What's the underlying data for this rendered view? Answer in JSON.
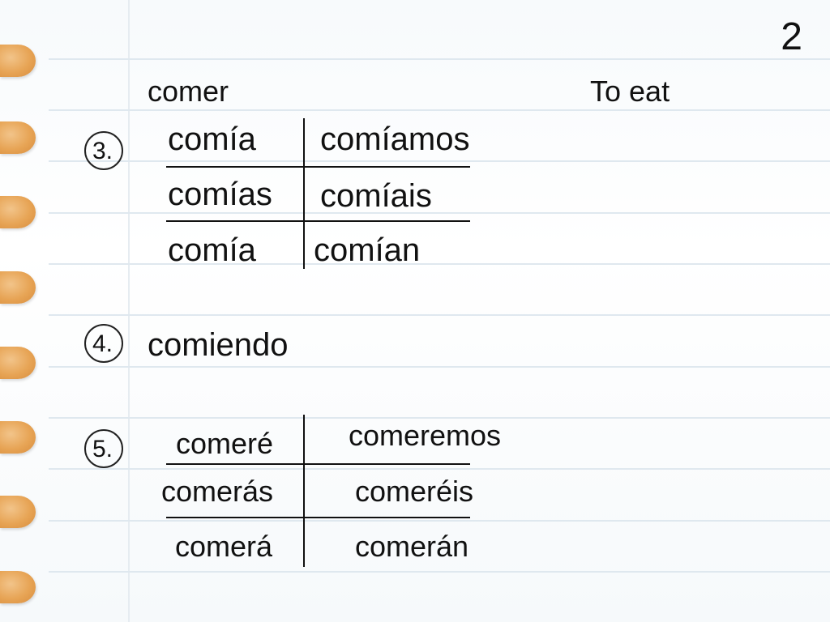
{
  "page_number": "2",
  "verb": "comer",
  "translation": "To eat",
  "items": [
    {
      "number": "3.",
      "forms": [
        "comía",
        "comíamos",
        "comías",
        "comíais",
        "comía",
        "comían"
      ]
    },
    {
      "number": "4.",
      "forms": [
        "comiendo"
      ]
    },
    {
      "number": "5.",
      "forms": [
        "comeré",
        "comeremos",
        "comerás",
        "comeréis",
        "comerá",
        "comerán"
      ]
    }
  ],
  "colors": {
    "hole": "#e7a455",
    "rule_line": "#dfe8ef",
    "ink": "#111111"
  }
}
